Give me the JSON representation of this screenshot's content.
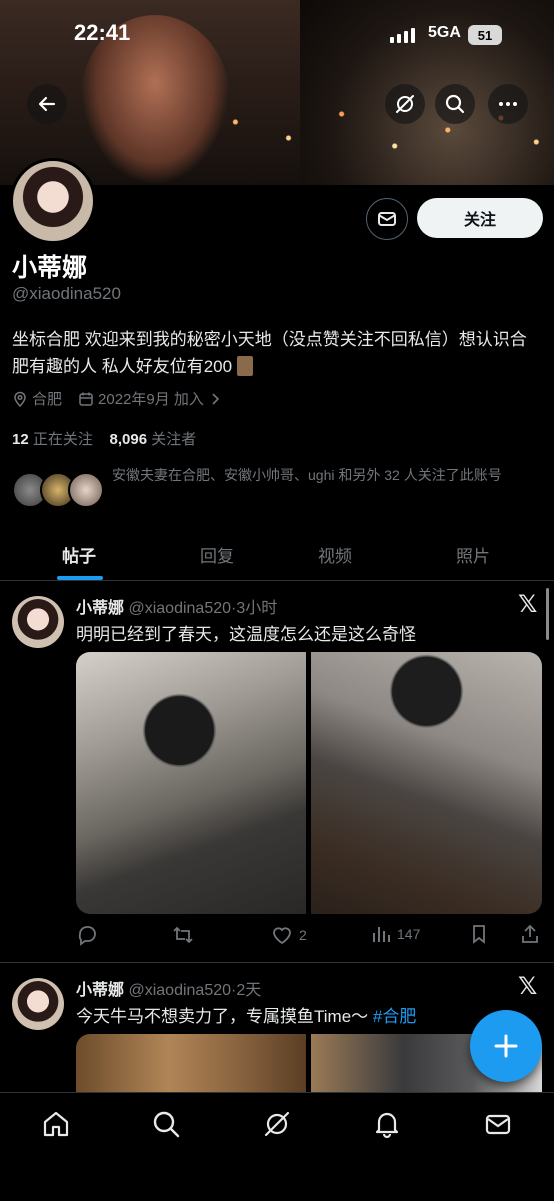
{
  "status_bar": {
    "time": "22:41",
    "network": "5GA",
    "battery": "51"
  },
  "header_icons": [
    "back-arrow-icon",
    "grok-icon",
    "search-icon",
    "more-icon"
  ],
  "profile": {
    "display_name": "小蒂娜",
    "handle": "@xiaodina520",
    "bio": "坐标合肥 欢迎来到我的秘密小天地（没点赞关注不回私信）想认识合肥有趣的人 私人好友位有200",
    "location": "合肥",
    "joined": "2022年9月 加入",
    "following_count": "12",
    "following_label": "正在关注",
    "followers_count": "8,096",
    "followers_label": "关注者",
    "follow_button": "关注",
    "mutuals_text": "安徽夫妻在合肥、安徽小帅哥、ughi 和另外 32 人关注了此账号"
  },
  "tabs": [
    "帖子",
    "回复",
    "视频",
    "照片"
  ],
  "active_tab": 0,
  "posts": [
    {
      "name": "小蒂娜",
      "handle_time": "@xiaodina520·3小时",
      "text": "明明已经到了春天，这温度怎么还是这么奇怪",
      "tag": "",
      "likes": "2",
      "views": "147"
    },
    {
      "name": "小蒂娜",
      "handle_time": "@xiaodina520·2天",
      "text": "今天牛马不想卖力了，专属摸鱼Time～ ",
      "tag": "#合肥"
    }
  ],
  "colors": {
    "accent": "#1d9bf0",
    "muted": "#71767b",
    "background": "#000000"
  },
  "bottom_nav": [
    "home-icon",
    "search-icon",
    "grok-icon",
    "notifications-icon",
    "messages-icon"
  ]
}
